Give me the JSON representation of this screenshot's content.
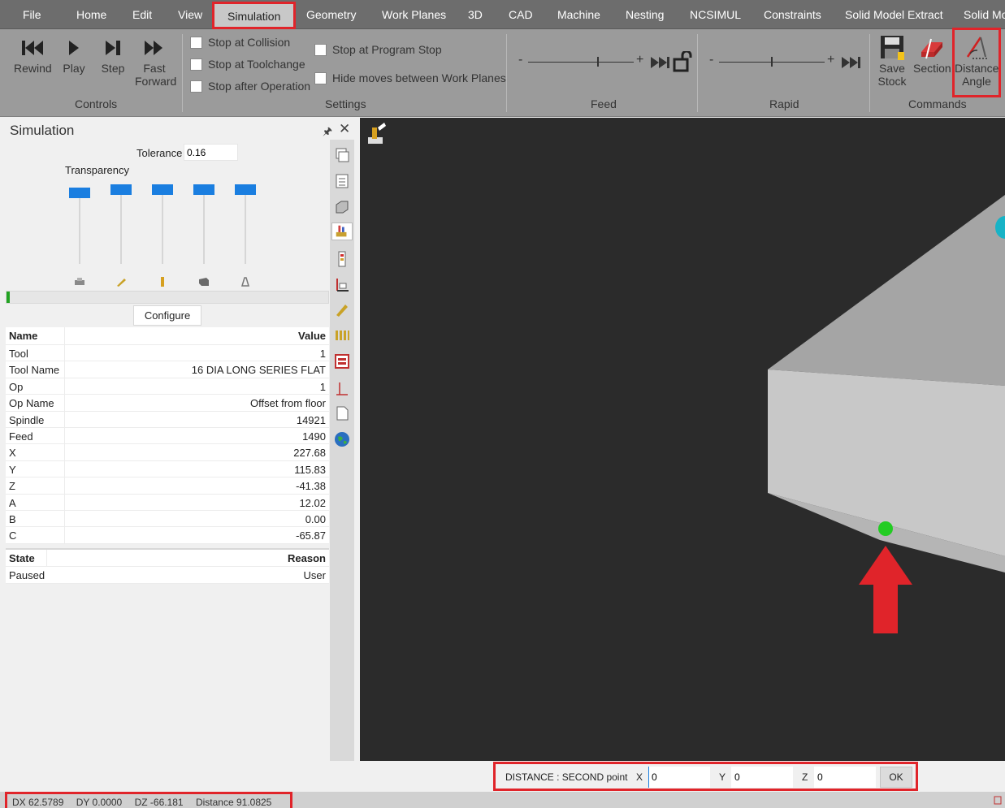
{
  "menu": {
    "items": [
      "File",
      "Home",
      "Edit",
      "View",
      "Simulation",
      "Geometry",
      "Work Planes",
      "3D",
      "CAD",
      "Machine",
      "Nesting",
      "NCSIMUL",
      "Constraints",
      "Solid Model Extract",
      "Solid Mo"
    ],
    "active": "Simulation"
  },
  "ribbon": {
    "controls": {
      "rewind": "Rewind",
      "play": "Play",
      "step": "Step",
      "fast_forward_1": "Fast",
      "fast_forward_2": "Forward",
      "group": "Controls"
    },
    "settings": {
      "stop_collision": "Stop at Collision",
      "stop_toolchange": "Stop at Toolchange",
      "stop_after_op": "Stop after Operation",
      "stop_program": "Stop at Program Stop",
      "hide_moves": "Hide moves between Work Planes",
      "group": "Settings"
    },
    "feed": {
      "minus": "-",
      "plus": "+",
      "group": "Feed"
    },
    "rapid": {
      "minus": "-",
      "plus": "+",
      "group": "Rapid"
    },
    "commands": {
      "save_1": "Save",
      "save_2": "Stock",
      "section": "Section",
      "distance_1": "Distance",
      "distance_2": "Angle",
      "group": "Commands"
    }
  },
  "panel": {
    "title": "Simulation",
    "tolerance_label": "Tolerance",
    "tolerance_value": "0.16",
    "transparency_label": "Transparency",
    "configure": "Configure",
    "progress_fraction": 0.01,
    "sliders": [
      0.05,
      0.0,
      0.0,
      0.0,
      0.0
    ],
    "props_header": {
      "name": "Name",
      "value": "Value"
    },
    "props": [
      {
        "k": "Tool",
        "v": "1"
      },
      {
        "k": "Tool Name",
        "v": "16 DIA  LONG SERIES FLAT"
      },
      {
        "k": "Op",
        "v": "1"
      },
      {
        "k": "Op Name",
        "v": "Offset from floor"
      },
      {
        "k": "Spindle",
        "v": "14921"
      },
      {
        "k": "Feed",
        "v": "1490"
      },
      {
        "k": "X",
        "v": "227.68"
      },
      {
        "k": "Y",
        "v": "115.83"
      },
      {
        "k": "Z",
        "v": "-41.38"
      },
      {
        "k": "A",
        "v": "12.02"
      },
      {
        "k": "B",
        "v": "0.00"
      },
      {
        "k": "C",
        "v": "-65.87"
      }
    ],
    "state_header": {
      "state": "State",
      "reason": "Reason"
    },
    "state": {
      "state": "Paused",
      "reason": "User"
    }
  },
  "command": {
    "prompt": "DISTANCE : SECOND point",
    "x_label": "X",
    "x_value": "0",
    "y_label": "Y",
    "y_value": "0",
    "z_label": "Z",
    "z_value": "0",
    "ok": "OK"
  },
  "status": {
    "dx": "DX 62.5789",
    "dy": "DY  0.0000",
    "dz": "DZ -66.181",
    "distance": "Distance 91.0825"
  },
  "colors": {
    "highlight": "#e0242a",
    "accent_blue": "#1a7ee0",
    "point_green": "#22cc22",
    "arrow_red": "#e0242a"
  }
}
